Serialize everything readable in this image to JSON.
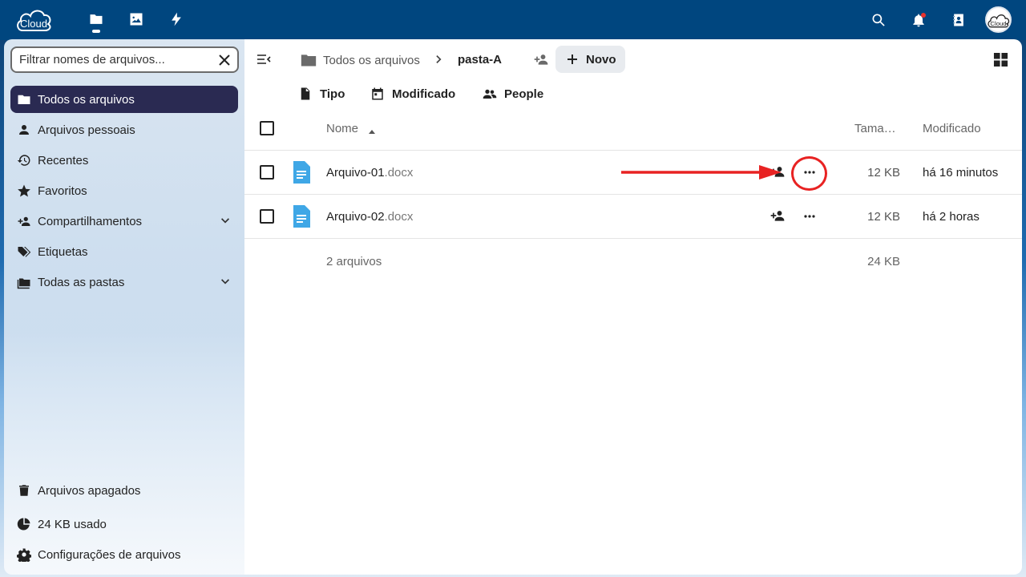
{
  "topbar": {
    "logo_text": "Cloud",
    "apps": [
      "files-icon",
      "photos-icon",
      "activity-icon"
    ],
    "right_icons": [
      "search-icon",
      "notifications-icon",
      "contacts-icon"
    ],
    "avatar_text": "Cloud"
  },
  "sidebar": {
    "search_placeholder": "Filtrar nomes de arquivos...",
    "items": [
      {
        "label": "Todos os arquivos",
        "icon": "folder-icon",
        "active": true
      },
      {
        "label": "Arquivos pessoais",
        "icon": "person-icon"
      },
      {
        "label": "Recentes",
        "icon": "history-icon"
      },
      {
        "label": "Favoritos",
        "icon": "star-icon"
      },
      {
        "label": "Compartilhamentos",
        "icon": "share-icon",
        "expandable": true
      },
      {
        "label": "Etiquetas",
        "icon": "tag-icon"
      },
      {
        "label": "Todas as pastas",
        "icon": "folders-icon",
        "expandable": true
      }
    ],
    "bottom": [
      {
        "label": "Arquivos apagados",
        "icon": "trash-icon"
      },
      {
        "label": "24 KB usado",
        "icon": "pie-chart-icon"
      },
      {
        "label": "Configurações de arquivos",
        "icon": "settings-icon"
      }
    ]
  },
  "main": {
    "breadcrumb_root": "Todos os arquivos",
    "breadcrumb_current": "pasta-A",
    "new_label": "Novo",
    "filters": [
      "Tipo",
      "Modificado",
      "People"
    ],
    "columns": {
      "name": "Nome",
      "size": "Tama…",
      "modified": "Modificado"
    },
    "files": [
      {
        "base": "Arquivo-01",
        "ext": ".docx",
        "size": "12 KB",
        "modified": "há 16 minutos"
      },
      {
        "base": "Arquivo-02",
        "ext": ".docx",
        "size": "12 KB",
        "modified": "há 2 horas"
      }
    ],
    "summary_count": "2 arquivos",
    "summary_size": "24 KB"
  },
  "colors": {
    "topbar": "#00467f",
    "active_nav": "#2a2a52",
    "file_icon": "#3fa7e6",
    "annotation": "#e82222"
  }
}
